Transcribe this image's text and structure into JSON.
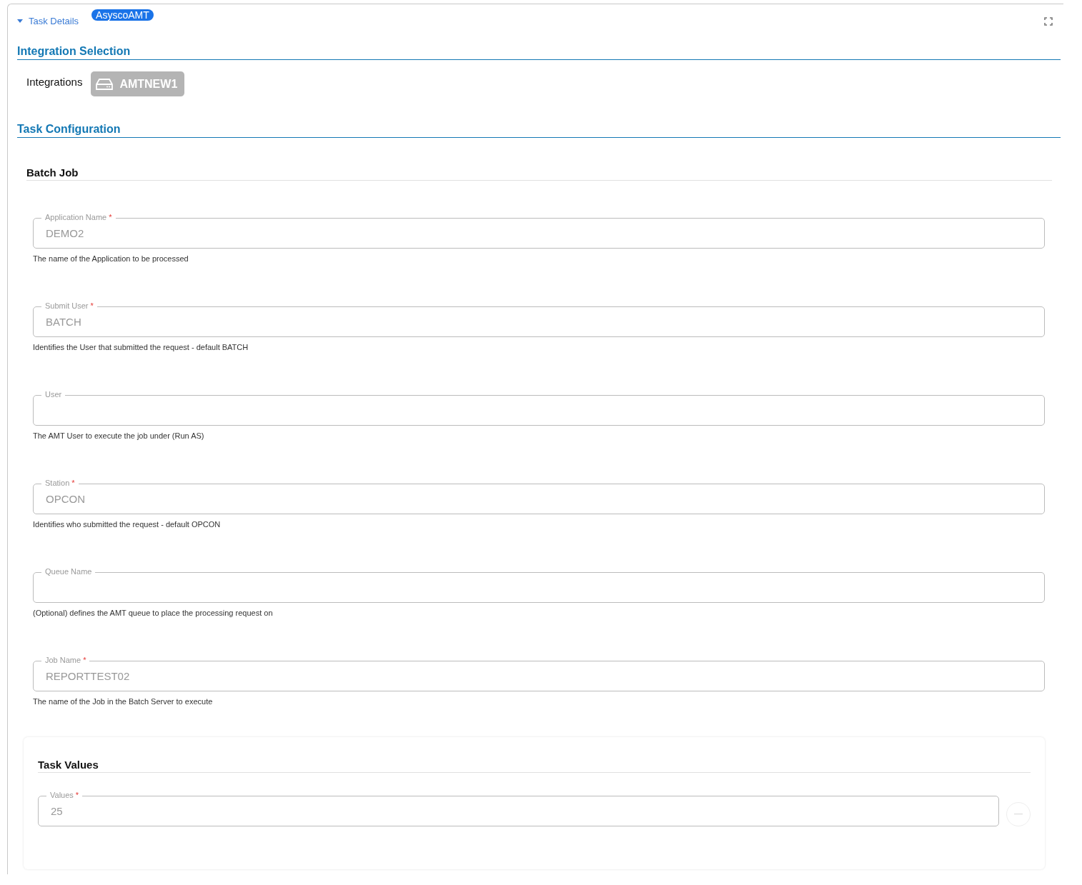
{
  "header": {
    "title": "Task Details",
    "expanded": true,
    "badge": "AsyscoAMT"
  },
  "integration_selection": {
    "title": "Integration Selection",
    "label": "Integrations",
    "chip": "AMTNEW1"
  },
  "task_configuration": {
    "title": "Task Configuration",
    "group_title": "Batch Job",
    "fields": [
      {
        "label": "Application Name",
        "required_mark": "*",
        "value": "DEMO2",
        "help": "The name of the Application to be processed"
      },
      {
        "label": "Submit User",
        "required_mark": "*",
        "value": "BATCH",
        "help": "Identifies the User that submitted the request - default BATCH"
      },
      {
        "label": "User",
        "help": "The AMT User to execute the job under (Run AS)"
      },
      {
        "label": "Station",
        "required_mark": "*",
        "value": "OPCON",
        "help": "Identifies who submitted the request - default OPCON"
      },
      {
        "label": "Queue Name",
        "help": "(Optional) defines the AMT queue to place the processing request on"
      },
      {
        "label": "Job Name",
        "required_mark": "*",
        "value": "REPORTTEST02",
        "help": "The name of the Job in the Batch Server to execute"
      }
    ]
  },
  "task_values": {
    "title": "Task Values",
    "fields": [
      {
        "label": "Values",
        "required_mark": "*",
        "value": "25"
      }
    ]
  }
}
